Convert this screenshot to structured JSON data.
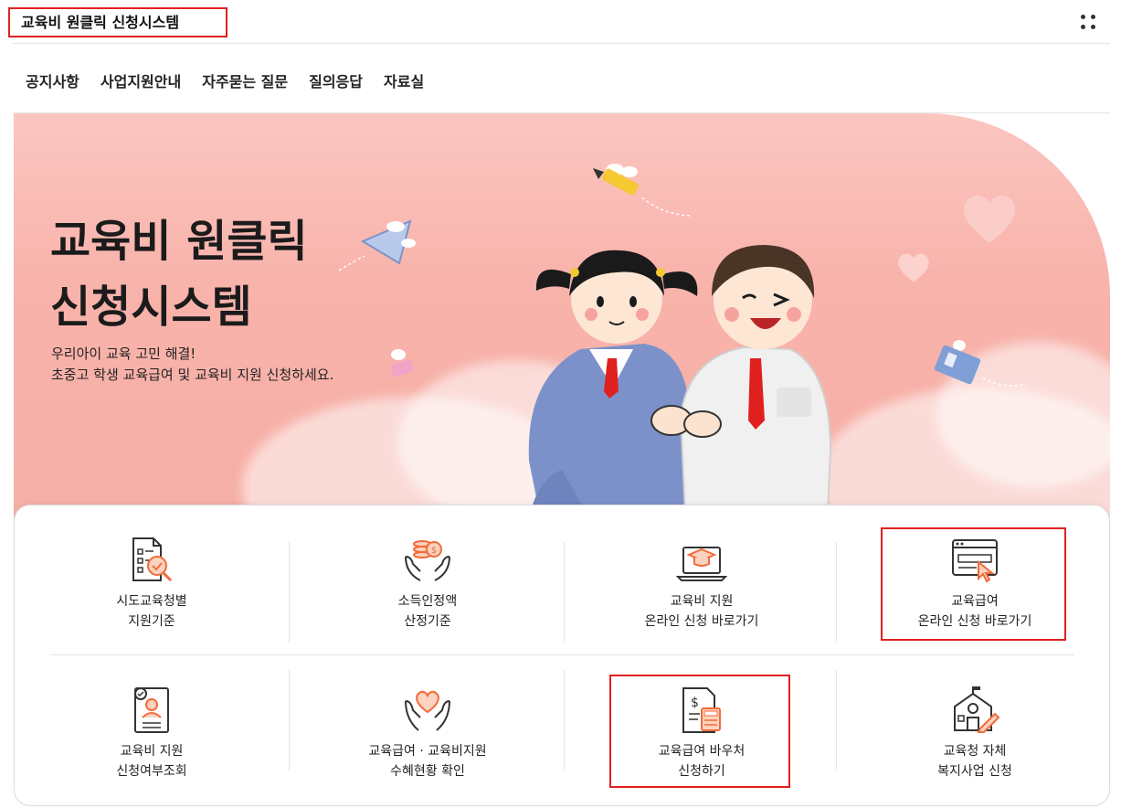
{
  "header": {
    "app_title": "교육비 원클릭 신청시스템",
    "menu_icon": "apps-grid-icon"
  },
  "nav": {
    "items": [
      "공지사항",
      "사업지원안내",
      "자주묻는 질문",
      "질의응답",
      "자료실"
    ]
  },
  "hero": {
    "title_line1": "교육비 원클릭",
    "title_line2": "신청시스템",
    "subtitle_line1": "우리아이 교육 고민 해결!",
    "subtitle_line2": "초중고 학생 교육급여 및 교육비 지원 신청하세요."
  },
  "tiles": [
    {
      "icon": "document-search-icon",
      "line1": "시도교육청별",
      "line2": "지원기준"
    },
    {
      "icon": "hands-coins-icon",
      "line1": "소득인정액",
      "line2": "산정기준"
    },
    {
      "icon": "laptop-graduation-icon",
      "line1": "교육비 지원",
      "line2": "온라인 신청 바로가기"
    },
    {
      "icon": "browser-cursor-icon",
      "line1": "교육급여",
      "line2": "온라인 신청 바로가기"
    },
    {
      "icon": "profile-document-icon",
      "line1": "교육비 지원",
      "line2": "신청여부조회"
    },
    {
      "icon": "hands-heart-icon",
      "line1": "교육급여 · 교육비지원",
      "line2": "수혜현황 확인"
    },
    {
      "icon": "invoice-calculator-icon",
      "line1": "교육급여 바우처",
      "line2": "신청하기"
    },
    {
      "icon": "school-pencil-icon",
      "line1": "교육청 자체",
      "line2": "복지사업 신청"
    }
  ],
  "colors": {
    "accent": "#f26b3a",
    "highlight": "#e0201f",
    "hero_bg": "#f8b3ab"
  }
}
